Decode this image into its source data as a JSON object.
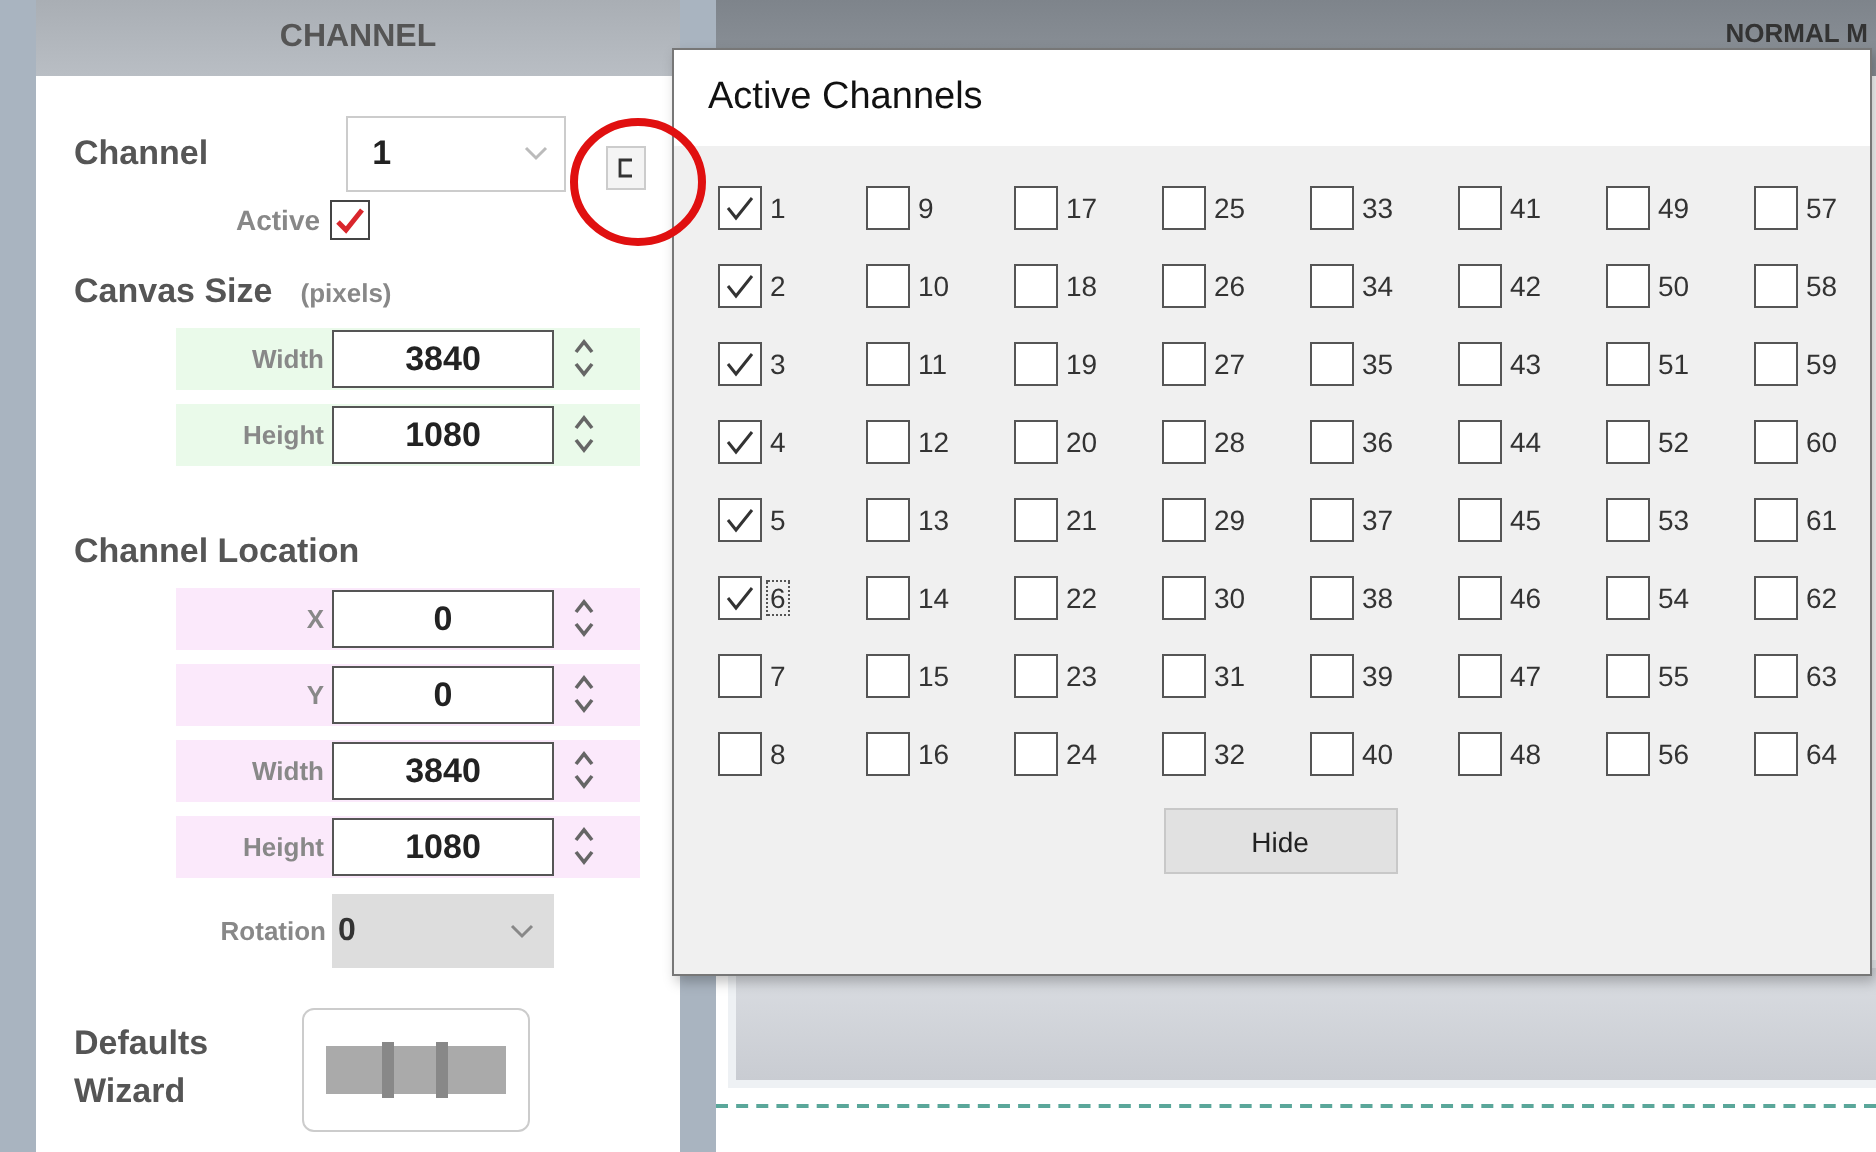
{
  "left_panel": {
    "header": "CHANNEL",
    "channel": {
      "label": "Channel",
      "value": "1"
    },
    "active": {
      "label": "Active",
      "checked": true
    },
    "canvas_size": {
      "title": "Canvas Size",
      "unit": "(pixels)",
      "fields": [
        {
          "label": "Width",
          "value": "3840"
        },
        {
          "label": "Height",
          "value": "1080"
        }
      ]
    },
    "channel_location": {
      "title": "Channel Location",
      "fields": [
        {
          "label": "X",
          "value": "0"
        },
        {
          "label": "Y",
          "value": "0"
        },
        {
          "label": "Width",
          "value": "3840"
        },
        {
          "label": "Height",
          "value": "1080"
        }
      ]
    },
    "rotation": {
      "label": "Rotation",
      "value": "0"
    },
    "defaults_wizard": {
      "label": "Defaults Wizard"
    }
  },
  "right_panel": {
    "header": "NORMAL M"
  },
  "dialog": {
    "title": "Active Channels",
    "channels": [
      {
        "label": "1",
        "checked": true,
        "focused": false
      },
      {
        "label": "2",
        "checked": true,
        "focused": false
      },
      {
        "label": "3",
        "checked": true,
        "focused": false
      },
      {
        "label": "4",
        "checked": true,
        "focused": false
      },
      {
        "label": "5",
        "checked": true,
        "focused": false
      },
      {
        "label": "6",
        "checked": true,
        "focused": true
      },
      {
        "label": "7",
        "checked": false,
        "focused": false
      },
      {
        "label": "8",
        "checked": false,
        "focused": false
      },
      {
        "label": "9",
        "checked": false,
        "focused": false
      },
      {
        "label": "10",
        "checked": false,
        "focused": false
      },
      {
        "label": "11",
        "checked": false,
        "focused": false
      },
      {
        "label": "12",
        "checked": false,
        "focused": false
      },
      {
        "label": "13",
        "checked": false,
        "focused": false
      },
      {
        "label": "14",
        "checked": false,
        "focused": false
      },
      {
        "label": "15",
        "checked": false,
        "focused": false
      },
      {
        "label": "16",
        "checked": false,
        "focused": false
      },
      {
        "label": "17",
        "checked": false,
        "focused": false
      },
      {
        "label": "18",
        "checked": false,
        "focused": false
      },
      {
        "label": "19",
        "checked": false,
        "focused": false
      },
      {
        "label": "20",
        "checked": false,
        "focused": false
      },
      {
        "label": "21",
        "checked": false,
        "focused": false
      },
      {
        "label": "22",
        "checked": false,
        "focused": false
      },
      {
        "label": "23",
        "checked": false,
        "focused": false
      },
      {
        "label": "24",
        "checked": false,
        "focused": false
      },
      {
        "label": "25",
        "checked": false,
        "focused": false
      },
      {
        "label": "26",
        "checked": false,
        "focused": false
      },
      {
        "label": "27",
        "checked": false,
        "focused": false
      },
      {
        "label": "28",
        "checked": false,
        "focused": false
      },
      {
        "label": "29",
        "checked": false,
        "focused": false
      },
      {
        "label": "30",
        "checked": false,
        "focused": false
      },
      {
        "label": "31",
        "checked": false,
        "focused": false
      },
      {
        "label": "32",
        "checked": false,
        "focused": false
      },
      {
        "label": "33",
        "checked": false,
        "focused": false
      },
      {
        "label": "34",
        "checked": false,
        "focused": false
      },
      {
        "label": "35",
        "checked": false,
        "focused": false
      },
      {
        "label": "36",
        "checked": false,
        "focused": false
      },
      {
        "label": "37",
        "checked": false,
        "focused": false
      },
      {
        "label": "38",
        "checked": false,
        "focused": false
      },
      {
        "label": "39",
        "checked": false,
        "focused": false
      },
      {
        "label": "40",
        "checked": false,
        "focused": false
      },
      {
        "label": "41",
        "checked": false,
        "focused": false
      },
      {
        "label": "42",
        "checked": false,
        "focused": false
      },
      {
        "label": "43",
        "checked": false,
        "focused": false
      },
      {
        "label": "44",
        "checked": false,
        "focused": false
      },
      {
        "label": "45",
        "checked": false,
        "focused": false
      },
      {
        "label": "46",
        "checked": false,
        "focused": false
      },
      {
        "label": "47",
        "checked": false,
        "focused": false
      },
      {
        "label": "48",
        "checked": false,
        "focused": false
      },
      {
        "label": "49",
        "checked": false,
        "focused": false
      },
      {
        "label": "50",
        "checked": false,
        "focused": false
      },
      {
        "label": "51",
        "checked": false,
        "focused": false
      },
      {
        "label": "52",
        "checked": false,
        "focused": false
      },
      {
        "label": "53",
        "checked": false,
        "focused": false
      },
      {
        "label": "54",
        "checked": false,
        "focused": false
      },
      {
        "label": "55",
        "checked": false,
        "focused": false
      },
      {
        "label": "56",
        "checked": false,
        "focused": false
      },
      {
        "label": "57",
        "checked": false,
        "focused": false
      },
      {
        "label": "58",
        "checked": false,
        "focused": false
      },
      {
        "label": "59",
        "checked": false,
        "focused": false
      },
      {
        "label": "60",
        "checked": false,
        "focused": false
      },
      {
        "label": "61",
        "checked": false,
        "focused": false
      },
      {
        "label": "62",
        "checked": false,
        "focused": false
      },
      {
        "label": "63",
        "checked": false,
        "focused": false
      },
      {
        "label": "64",
        "checked": false,
        "focused": false
      }
    ],
    "buttons": [
      "Hide"
    ]
  }
}
